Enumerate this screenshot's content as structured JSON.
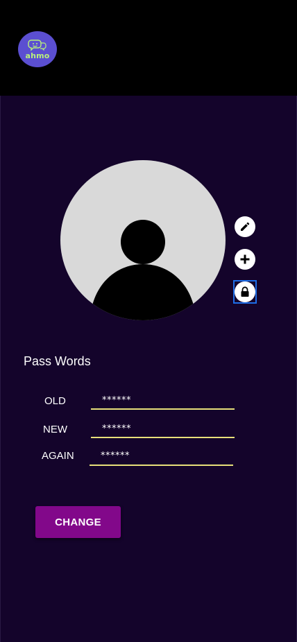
{
  "header": {
    "logo_text": "ahmo",
    "logo_icon": "chat-bubbles-logo",
    "background": "#000000"
  },
  "profile": {
    "avatar_icon": "person-silhouette-icon",
    "actions": [
      {
        "icon": "pencil-icon",
        "label": "edit"
      },
      {
        "icon": "plus-icon",
        "label": "add"
      },
      {
        "icon": "lock-icon",
        "label": "lock"
      }
    ]
  },
  "password_section": {
    "title": "Pass Words",
    "fields": [
      {
        "label": "OLD",
        "value": "******"
      },
      {
        "label": "NEW",
        "value": "******"
      },
      {
        "label": "AGAIN",
        "value": "******"
      }
    ]
  },
  "change_button": {
    "label": "CHANGE"
  },
  "colors": {
    "page_background": "#14042b",
    "button_background": "#82088a",
    "underline": "#e8e07a",
    "logo_background": "#5b4fd1",
    "logo_text": "#b9f27a",
    "focus_border": "#1e6ee8"
  }
}
